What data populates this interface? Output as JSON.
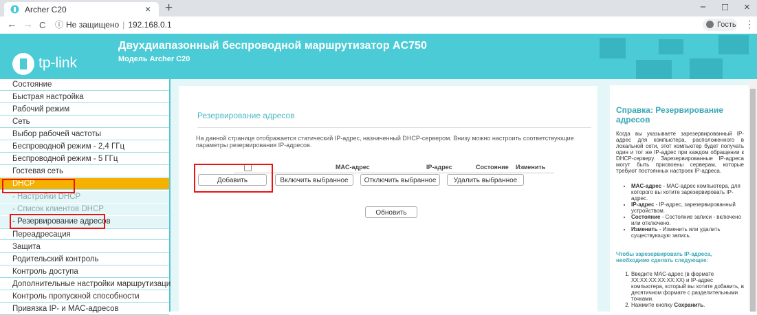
{
  "browser": {
    "tab_title": "Archer C20",
    "tab_close": "×",
    "new_tab": "+",
    "back": "←",
    "forward": "→",
    "reload": "C",
    "security_icon": "ⓘ",
    "security_text": "Не защищено",
    "separator": "|",
    "url": "192.168.0.1",
    "profile_label": "Гость",
    "menu_icon": "⋮",
    "minimize": "−",
    "maximize": "□",
    "close": "×"
  },
  "header": {
    "brand": "tp-link",
    "title": "Двухдиапазонный беспроводной маршрутизатор AC750",
    "model": "Модель Archer C20",
    "color": "#4acbd6"
  },
  "sidebar": {
    "items": [
      {
        "label": "Состояние"
      },
      {
        "label": "Быстрая настройка"
      },
      {
        "label": "Рабочий режим"
      },
      {
        "label": "Сеть"
      },
      {
        "label": "Выбор рабочей частоты"
      },
      {
        "label": "Беспроводной режим - 2,4 ГГц"
      },
      {
        "label": "Беспроводной режим - 5 ГГц"
      },
      {
        "label": "Гостевая сеть"
      },
      {
        "label": "DHCP"
      },
      {
        "label": "- Настройки DHCP"
      },
      {
        "label": "- Список клиентов DHCP"
      },
      {
        "label": "- Резервирование адресов"
      },
      {
        "label": "Переадресация"
      },
      {
        "label": "Защита"
      },
      {
        "label": "Родительский контроль"
      },
      {
        "label": "Контроль доступа"
      },
      {
        "label": "Дополнительные настройки маршрутизации"
      },
      {
        "label": "Контроль пропускной способности"
      },
      {
        "label": "Привязка IP- и MAC-адресов"
      }
    ],
    "active_color": "#f6b100"
  },
  "main": {
    "title": "Резервирование адресов",
    "description": "На данной странице отображается статический IP-адрес, назначенный DHCP-сервером. Внизу можно настроить соответствующие параметры резервирования IP-адресов.",
    "table_headers": {
      "mac": "MAC-адрес",
      "ip": "IP-адрес",
      "status": "Состояние",
      "edit": "Изменить"
    },
    "buttons": {
      "add": "Добавить",
      "enable_selected": "Включить выбранное",
      "disable_selected": "Отключить выбранное",
      "delete_selected": "Удалить выбранное",
      "refresh": "Обновить"
    }
  },
  "help": {
    "title": "Справка: Резервирование адресов",
    "intro": "Когда вы указываете зарезервированный IP-адрес для компьютера, расположенного в локальной сети, этот компьютер будет получать один и тот же IP-адрес при каждом обращении к DHCP-серверу. Зарезервированные IP-адреса могут быть присвоены серверам, которые требуют постоянных настроек IP-адреса.",
    "items": [
      {
        "term": "MAC-адрес",
        "text": " - MAC-адрес компьютера, для которого вы хотите зарезервировать IP-адрес."
      },
      {
        "term": "IP-адрес",
        "text": " - IP-адрес, зарезервированный устройством."
      },
      {
        "term": "Состояние",
        "text": " - Состояние записи - включено или отключено."
      },
      {
        "term": "Изменить",
        "text": " - Изменить или удалить существующую запись."
      }
    ],
    "steps_title": "Чтобы зарезервировать IP-адреса, необходимо сделать следующее:",
    "steps": [
      {
        "text": "Введите MAC-адрес (в формате XX:XX:XX:XX:XX:XX) и IP-адрес компьютера, который вы хотите добавить, в десятичном формате с разделительными точками."
      },
      {
        "text": "Нажмите кнопку ",
        "bold": "Сохранить",
        "tail": "."
      }
    ]
  }
}
